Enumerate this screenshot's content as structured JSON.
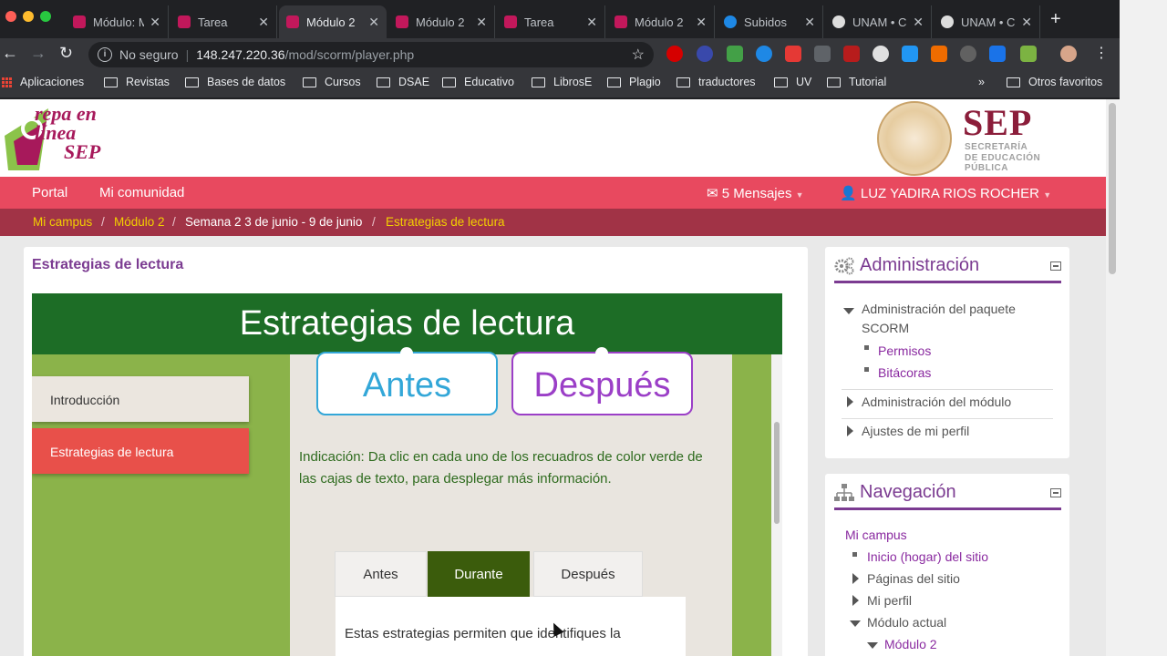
{
  "browser": {
    "tabs": [
      {
        "title": "Módulo: M",
        "favicon_color": "#c2185b"
      },
      {
        "title": "Tarea",
        "favicon_color": "#c2185b"
      },
      {
        "title": "Módulo 2",
        "favicon_color": "#c2185b",
        "active": true
      },
      {
        "title": "Módulo 2",
        "favicon_color": "#c2185b"
      },
      {
        "title": "Tarea",
        "favicon_color": "#c2185b"
      },
      {
        "title": "Módulo 2",
        "favicon_color": "#c2185b"
      },
      {
        "title": "Subidos",
        "favicon_color": "#1e88e5"
      },
      {
        "title": "UNAM • C",
        "favicon_color": "#dddddd"
      },
      {
        "title": "UNAM • C",
        "favicon_color": "#dddddd"
      }
    ],
    "omnibox": {
      "security": "No seguro",
      "host": "148.247.220.36",
      "path": "/mod/scorm/player.php"
    },
    "bookmarks": [
      "Aplicaciones",
      "Revistas",
      "Bases de datos",
      "Cursos",
      "DSAE",
      "Educativo",
      "LibrosE",
      "Plagio",
      "traductores",
      "UV",
      "Tutorial"
    ],
    "bookmarks_overflow": "»",
    "other_bookmarks": "Otros favoritos"
  },
  "site": {
    "logo_text": [
      "repa en",
      "línea",
      "SEP"
    ],
    "sep_title": "SEP",
    "sep_subtitle": [
      "SECRETARÍA",
      "DE EDUCACIÓN",
      "PÚBLICA"
    ]
  },
  "navbar": {
    "portal": "Portal",
    "community": "Mi comunidad",
    "messages": "5 Mensajes",
    "user": "LUZ YADIRA RIOS ROCHER"
  },
  "breadcrumb": {
    "items": [
      "Mi campus",
      "Módulo 2",
      "Semana 2 3 de junio - 9 de junio",
      "Estrategias de lectura"
    ],
    "separator": "/"
  },
  "main": {
    "title": "Estrategias de lectura"
  },
  "scorm": {
    "header": "Estrategias de lectura",
    "sidebar": [
      "Introducción",
      "Estrategias de lectura"
    ],
    "boxes": [
      "Antes",
      "Después"
    ],
    "instruction": "Indicación: Da clic en cada uno de los recuadros de color verde de las cajas de texto, para desplegar más información.",
    "tabs": [
      "Antes",
      "Durante",
      "Después"
    ],
    "active_tab": "Durante",
    "tab_text": "Estas estrategias permiten que identifiques la"
  },
  "admin_block": {
    "title": "Administración",
    "items": [
      {
        "label": "Administración del paquete SCORM",
        "kind": "expanded"
      },
      {
        "label": "Permisos",
        "kind": "link"
      },
      {
        "label": "Bitácoras",
        "kind": "link"
      },
      {
        "label": "Administración del módulo",
        "kind": "collapsed"
      },
      {
        "label": "Ajustes de mi perfil",
        "kind": "collapsed"
      }
    ]
  },
  "nav_block": {
    "title": "Navegación",
    "items": [
      {
        "label": "Mi campus",
        "kind": "link"
      },
      {
        "label": "Inicio (hogar) del sitio",
        "kind": "link"
      },
      {
        "label": "Páginas del sitio",
        "kind": "collapsed"
      },
      {
        "label": "Mi perfil",
        "kind": "collapsed"
      },
      {
        "label": "Módulo actual",
        "kind": "expanded"
      },
      {
        "label": "Módulo 2",
        "kind": "link"
      }
    ]
  },
  "colors": {
    "navbar": "#e8495f",
    "breadcrumb_bg": "#a13346",
    "breadcrumb_link": "#f2d000",
    "accent": "#7b3b91",
    "scorm_header": "#1d6d26",
    "scorm_green": "#8bb34a",
    "active_sidebar": "#e8504a",
    "active_tab": "#3b5c0c"
  }
}
